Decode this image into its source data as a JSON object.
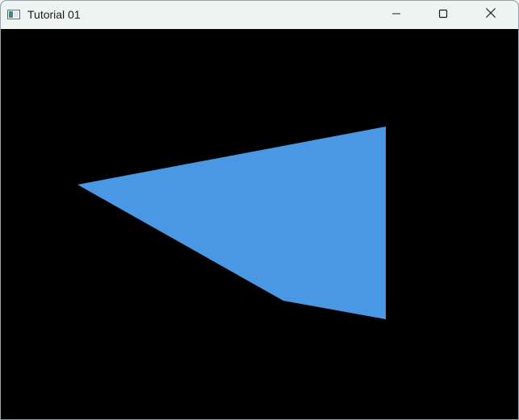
{
  "window": {
    "title": "Tutorial 01",
    "icon": "window-app-icon",
    "controls": [
      {
        "name": "minimize",
        "icon": "minimize-icon"
      },
      {
        "name": "maximize",
        "icon": "maximize-icon"
      },
      {
        "name": "close",
        "icon": "close-icon"
      }
    ]
  },
  "canvas": {
    "background_color": "#000000",
    "shape": {
      "type": "quadrilateral",
      "fill_color": "#4a98e4"
    }
  }
}
